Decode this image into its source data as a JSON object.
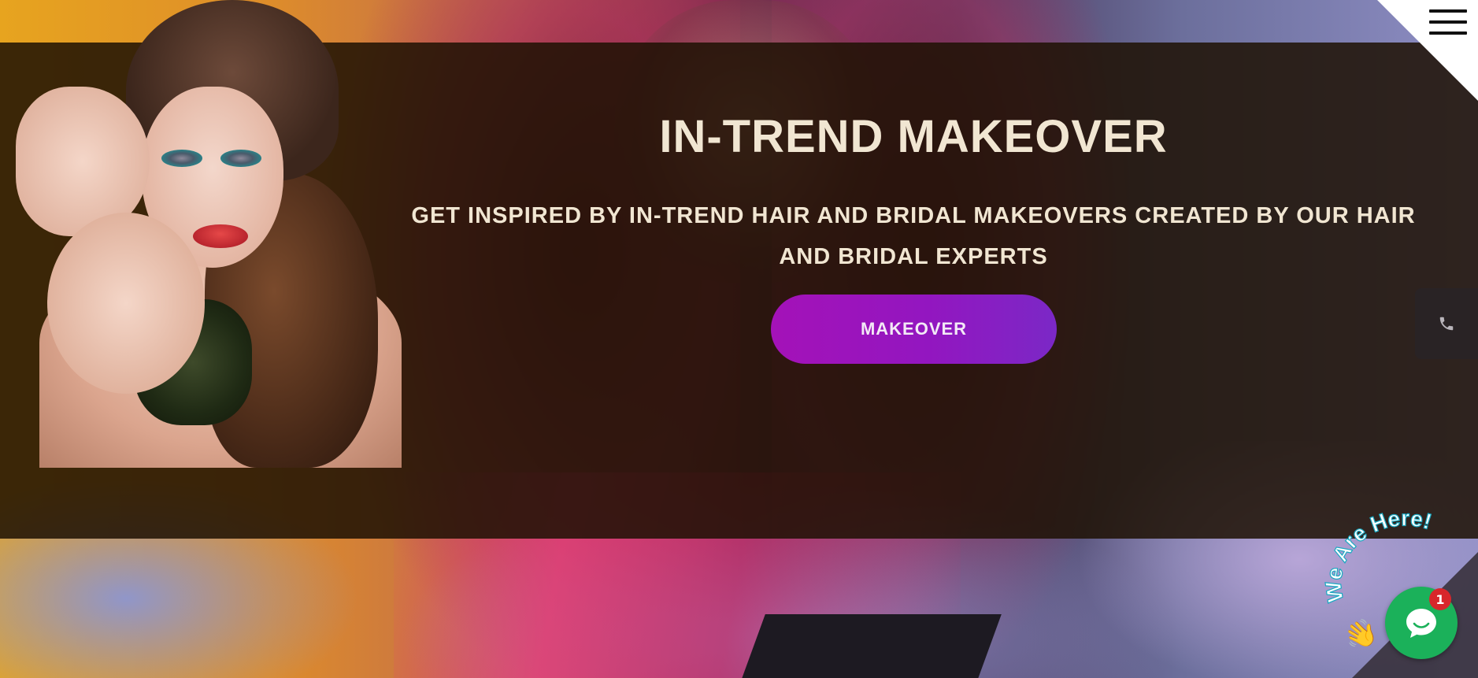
{
  "hero": {
    "title": "IN-TREND MAKEOVER",
    "subtitle": "GET INSPIRED BY IN-TREND HAIR AND BRIDAL MAKEOVERS CREATED BY OUR HAIR AND BRIDAL EXPERTS",
    "cta_label": "MAKEOVER"
  },
  "header": {
    "menu_icon": "hamburger-menu-icon"
  },
  "side_tab": {
    "icon": "phone-icon"
  },
  "chat": {
    "banner_text": "We Are Here!",
    "badge_count": "1",
    "wave_glyph": "👋",
    "icon": "chat-bubble-icon",
    "color": "#1bb15a"
  },
  "colors": {
    "accent": "#a412b8",
    "title_text": "#f1e6d2"
  }
}
